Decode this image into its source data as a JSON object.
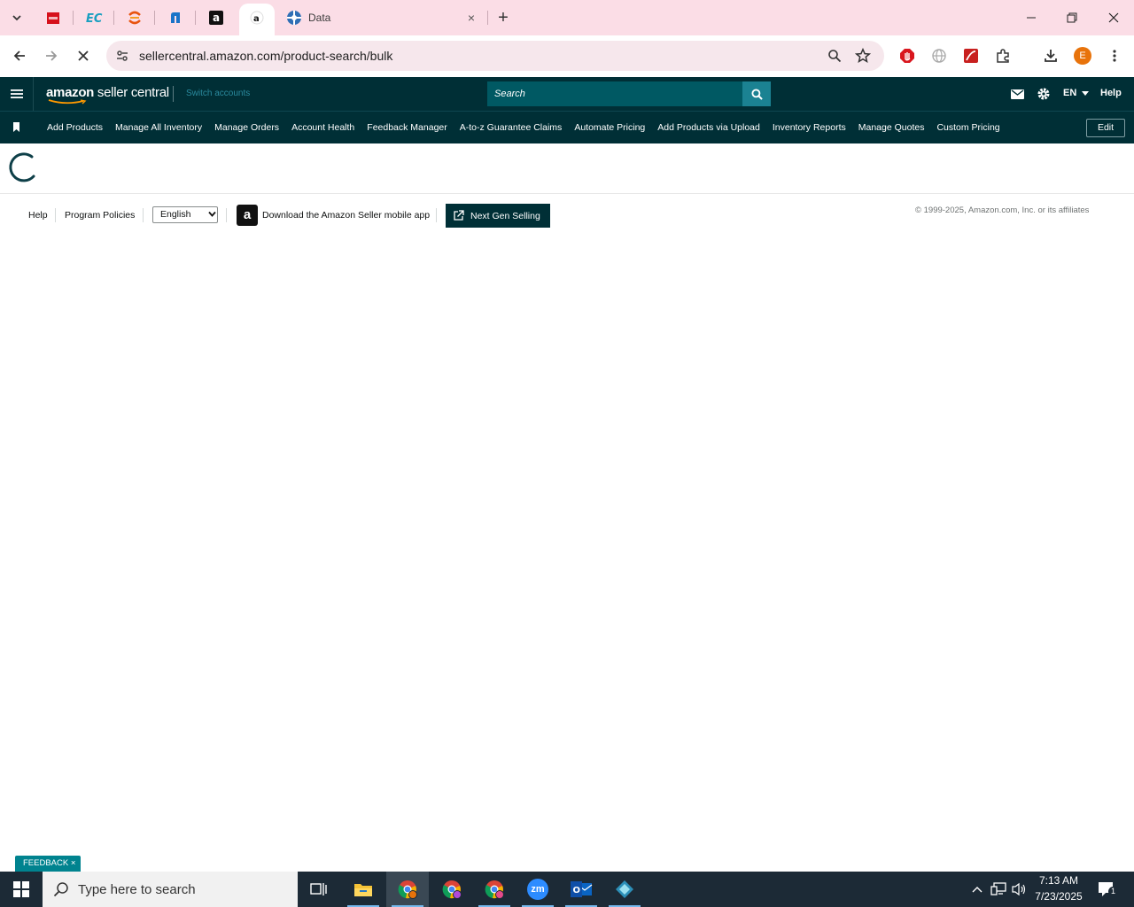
{
  "browser": {
    "active_tab_title": "",
    "data_tab": {
      "title": "Data",
      "close": "×"
    },
    "new_tab": "+",
    "url": "sellercentral.amazon.com/product-search/bulk",
    "profile_initial": "E",
    "accent": "#fbdde6"
  },
  "header": {
    "logo_brand": "amazon",
    "logo_suffix": " seller central",
    "switch_accounts": "Switch accounts",
    "search_placeholder": "Search",
    "language": "EN",
    "help": "Help",
    "brand_color": "#002f36"
  },
  "nav": {
    "links": [
      "Add Products",
      "Manage All Inventory",
      "Manage Orders",
      "Account Health",
      "Feedback Manager",
      "A-to-z Guarantee Claims",
      "Automate Pricing",
      "Add Products via Upload",
      "Inventory Reports",
      "Manage Quotes",
      "Custom Pricing"
    ],
    "edit": "Edit"
  },
  "footer": {
    "help": "Help",
    "program_policies": "Program Policies",
    "language_selected": "English",
    "app_icon_letter": "a",
    "app_download": "Download the Amazon Seller mobile app",
    "next_gen": "Next Gen Selling",
    "copyright": "© 1999-2025, Amazon.com, Inc. or its affiliates"
  },
  "feedback": {
    "label": "FEEDBACK ×"
  },
  "taskbar": {
    "search_placeholder": "Type here to search",
    "time": "7:13 AM",
    "date": "7/23/2025",
    "notification_count": "1",
    "zoom_label": "zm"
  }
}
